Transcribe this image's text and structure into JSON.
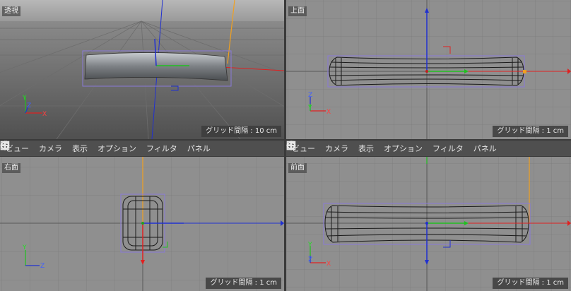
{
  "viewports": {
    "perspective": {
      "label": "透視",
      "grid": "グリッド間隔 : 10 cm"
    },
    "top": {
      "label": "上面",
      "grid": "グリッド間隔 : 1 cm"
    },
    "right": {
      "label": "右面",
      "grid": "グリッド間隔 : 1 cm"
    },
    "front": {
      "label": "前面",
      "grid": "グリッド間隔 : 1 cm"
    }
  },
  "menu": {
    "view": "ビュー",
    "camera": "カメラ",
    "display": "表示",
    "options": "オプション",
    "filter": "フィルタ",
    "panel": "パネル"
  },
  "nav_icons": [
    "move-view-icon",
    "zoom-view-icon",
    "rotate-view-icon",
    "maximize-view-icon"
  ],
  "axis_labels": {
    "x": "X",
    "y": "Y",
    "z": "Z"
  },
  "colors": {
    "viewport_bg": "#8f8f8f",
    "menubar_bg": "#4f4f4f",
    "x_axis": "#e02020",
    "y_axis": "#20c020",
    "z_axis": "#2030d0",
    "selection_box": "#8a7ad8",
    "object_outline": "#1a1a1a",
    "camera_line": "#f0a020"
  }
}
